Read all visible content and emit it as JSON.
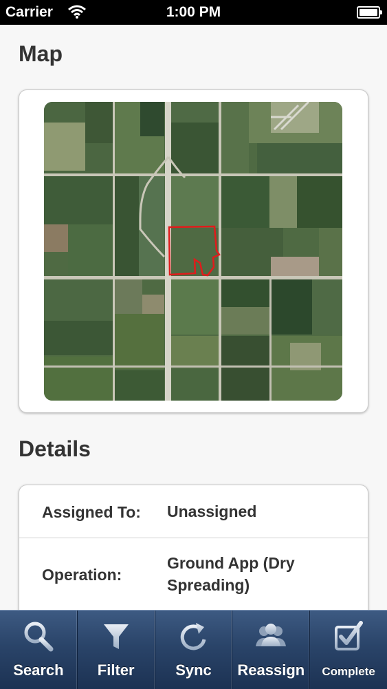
{
  "status_bar": {
    "carrier": "Carrier",
    "time": "1:00 PM"
  },
  "map_section": {
    "title": "Map"
  },
  "details_section": {
    "title": "Details",
    "rows": [
      {
        "label": "Assigned To:",
        "value": "Unassigned"
      },
      {
        "label": "Operation:",
        "value": "Ground App (Dry Spreading)"
      }
    ]
  },
  "tab_bar": {
    "tabs": [
      {
        "label": "Search",
        "icon": "search-icon"
      },
      {
        "label": "Filter",
        "icon": "filter-icon"
      },
      {
        "label": "Sync",
        "icon": "sync-icon"
      },
      {
        "label": "Reassign",
        "icon": "people-icon"
      },
      {
        "label": "Complete",
        "icon": "checkbox-icon"
      }
    ]
  },
  "colors": {
    "tab_bar": "#2a4469",
    "field_boundary": "#e11b1b",
    "status_bar": "#000000"
  }
}
